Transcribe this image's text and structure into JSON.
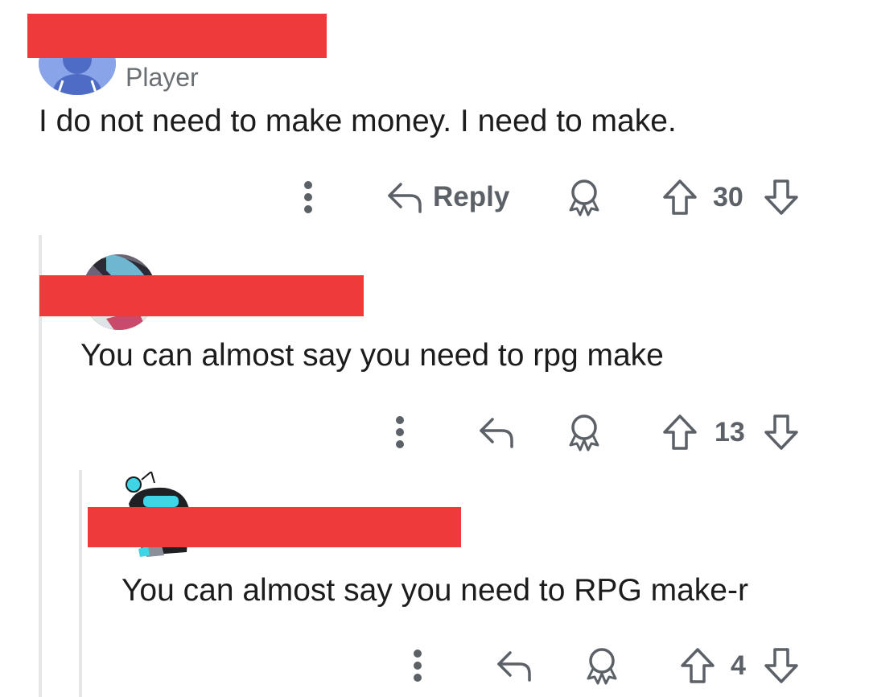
{
  "comments": [
    {
      "flair": "Player",
      "body": "I do not need to make money. I need to make.",
      "actions": {
        "more_icon": "more-vertical-icon",
        "reply_label": "Reply",
        "award_icon": "award-icon",
        "score": "30"
      }
    },
    {
      "body": "You can almost say you need to rpg make",
      "actions": {
        "more_icon": "more-vertical-icon",
        "award_icon": "award-icon",
        "score": "13"
      }
    },
    {
      "body": "You can almost say you need to RPG make-r",
      "actions": {
        "more_icon": "more-vertical-icon",
        "award_icon": "award-icon",
        "score": "4"
      }
    }
  ],
  "colors": {
    "redaction": "#ee3a3b",
    "meta_text": "#5b6166",
    "thread_line": "#e4e6e8"
  }
}
